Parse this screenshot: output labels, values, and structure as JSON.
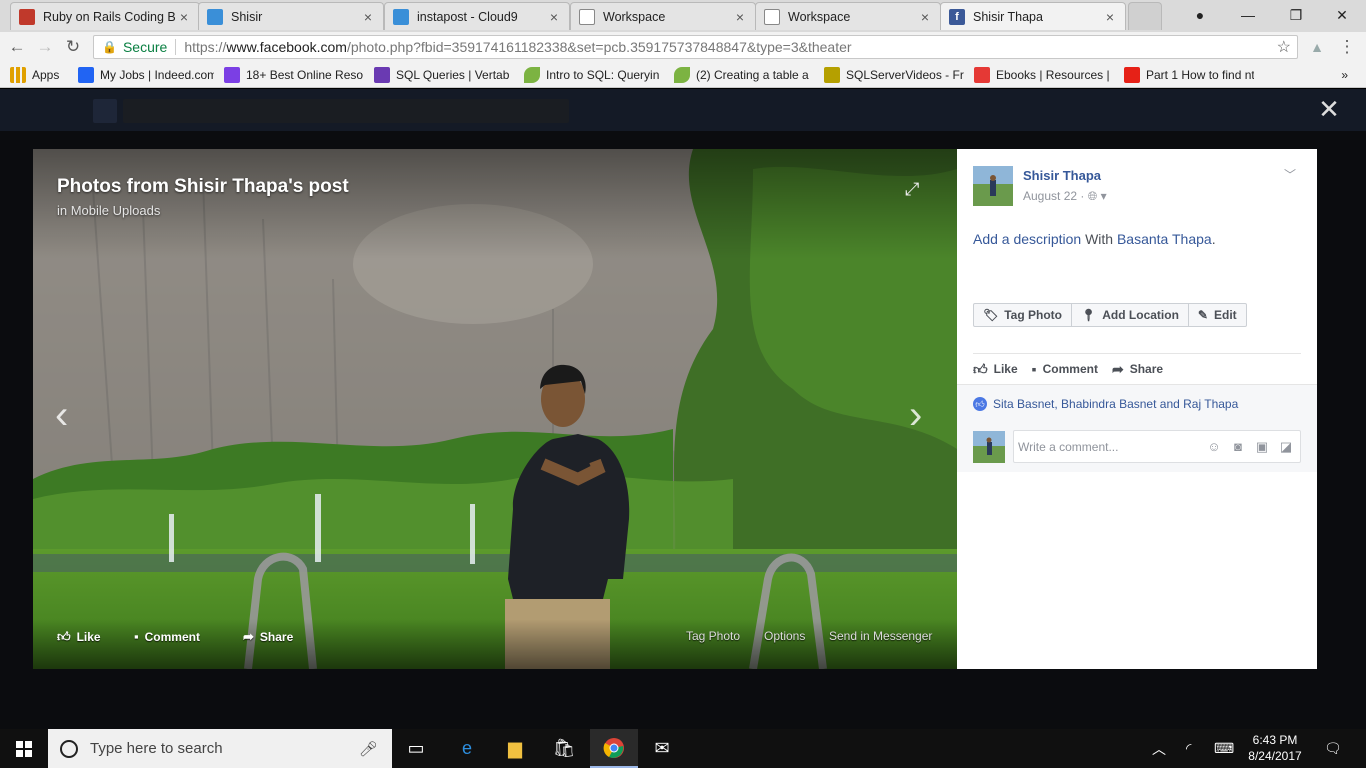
{
  "browser": {
    "tabs": [
      {
        "title": "Ruby on Rails Coding B",
        "icon": "rails-icon"
      },
      {
        "title": "Shisir",
        "icon": "cloud9-icon"
      },
      {
        "title": "instapost - Cloud9",
        "icon": "cloud9-icon"
      },
      {
        "title": "Workspace",
        "icon": "page-icon"
      },
      {
        "title": "Workspace",
        "icon": "page-icon"
      },
      {
        "title": "Shisir Thapa",
        "icon": "facebook-icon",
        "active": true
      }
    ],
    "address": {
      "secure_label": "Secure",
      "url_prefix": "https://",
      "url_host": "www.facebook.com",
      "url_path": "/photo.php?fbid=359174161182338&set=pcb.359175737848847&type=3&theater"
    },
    "bookmarks": [
      {
        "label": "Apps",
        "color": "#e0a000"
      },
      {
        "label": "My Jobs | Indeed.com",
        "color": "#2164f3"
      },
      {
        "label": "18+ Best Online Reso",
        "color": "#7b3fe4"
      },
      {
        "label": "SQL Queries | Vertab",
        "color": "#6a3ab2"
      },
      {
        "label": "Intro to SQL: Queryin",
        "color": "#7cb342"
      },
      {
        "label": "(2) Creating a table a",
        "color": "#7cb342"
      },
      {
        "label": "SQLServerVideos - Fr",
        "color": "#b5a000"
      },
      {
        "label": "Ebooks | Resources |",
        "color": "#e53935"
      },
      {
        "label": "Part 1 How to find nt",
        "color": "#e62117"
      }
    ]
  },
  "theater": {
    "title": "Photos from Shisir Thapa's post",
    "subtitle": "in Mobile Uploads",
    "actions": {
      "like": "Like",
      "comment": "Comment",
      "share": "Share",
      "tag_photo": "Tag Photo",
      "options": "Options",
      "send_in_messenger": "Send in Messenger"
    }
  },
  "sidebar": {
    "author": "Shisir Thapa",
    "date": "August 22 ·",
    "description_link": "Add a description",
    "with_text": "With",
    "tagged": "Basanta Thapa",
    "period": ".",
    "tools": {
      "tag_photo": "Tag Photo",
      "add_location": "Add Location",
      "edit": "Edit"
    },
    "actions": {
      "like": "Like",
      "comment": "Comment",
      "share": "Share"
    },
    "likers": "Sita Basnet, Bhabindra Basnet and Raj Thapa",
    "comment_placeholder": "Write a comment..."
  },
  "taskbar": {
    "search_placeholder": "Type here to search",
    "time": "6:43 PM",
    "date": "8/24/2017"
  }
}
